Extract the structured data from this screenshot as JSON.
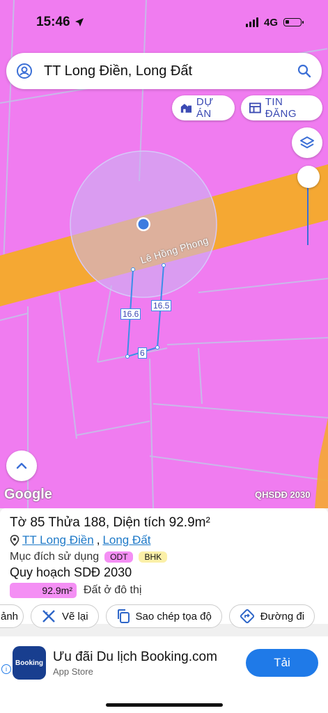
{
  "status_bar": {
    "time": "15:46",
    "network": "4G"
  },
  "search": {
    "text": "TT Long Điền, Long Đất"
  },
  "chips": {
    "du_an": "DỰ ÁN",
    "tin_dang": "TIN ĐĂNG"
  },
  "map": {
    "road_name": "Lê Hồng Phong",
    "dimensions": {
      "left": "16.6",
      "right": "16.5",
      "bottom": "6"
    },
    "google_label": "Google",
    "overlay_label": "QHSDĐ 2030",
    "colors": {
      "zone": "#f07cf0",
      "road": "#f5a833",
      "parcel_line": "#3a8ee8"
    }
  },
  "parcel": {
    "title": "Tờ 85 Thửa 188, Diện tích 92.9m²",
    "location_ward": "TT Long Điền",
    "location_separator": ",",
    "location_district": "Long Đất",
    "purpose_label": "Mục đích sử dụng",
    "tags": [
      "ODT",
      "BHK"
    ],
    "plan_title": "Quy hoạch SDĐ 2030",
    "plan_area": "92.9m²",
    "plan_desc": "Đất ở đô thị"
  },
  "actions": {
    "partial": "ảnh",
    "redraw": "Vẽ lại",
    "copy_coords": "Sao chép tọa độ",
    "directions": "Đường đi"
  },
  "ad": {
    "logo_text": "Booking",
    "title": "Ưu đãi Du lịch Booking.com",
    "subtitle": "App Store",
    "button": "Tải",
    "info": "i"
  }
}
